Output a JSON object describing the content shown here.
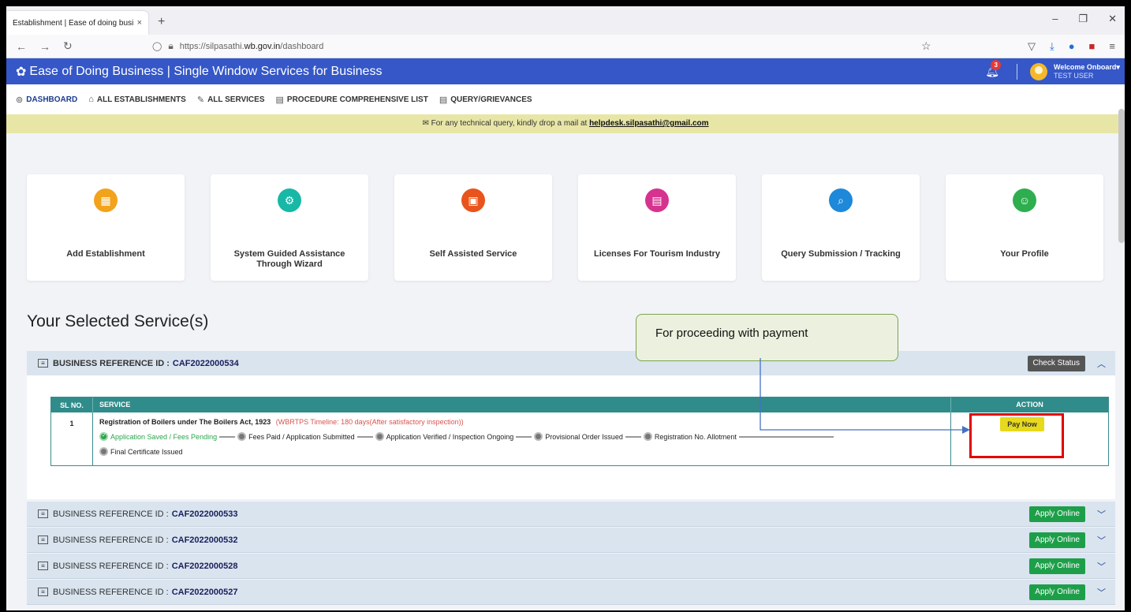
{
  "browser": {
    "tab_title": "Establishment | Ease of doing busin",
    "tab_close": "×",
    "new_tab": "+",
    "url_prefix": "https://silpasathi.",
    "url_host": "wb.gov.in",
    "url_path": "/dashboard",
    "win_minimize": "–",
    "win_restore": "❐",
    "win_close": "✕"
  },
  "header": {
    "title": "Ease of Doing Business | Single Window Services for Business",
    "notification_count": "3",
    "welcome": "Welcome Onboard",
    "user": "TEST USER"
  },
  "menu": [
    {
      "label": "DASHBOARD",
      "icon": "dashboard-icon",
      "glyph": "⊚"
    },
    {
      "label": "ALL ESTABLISHMENTS",
      "icon": "building-icon",
      "glyph": "⌂"
    },
    {
      "label": "ALL SERVICES",
      "icon": "wrench-icon",
      "glyph": "✎"
    },
    {
      "label": "PROCEDURE COMPREHENSIVE LIST",
      "icon": "list-icon",
      "glyph": "▤"
    },
    {
      "label": "QUERY/GRIEVANCES",
      "icon": "list-icon",
      "glyph": "▤"
    }
  ],
  "notice": {
    "text": "For any technical query, kindly drop a mail at",
    "email": "helpdesk.silpasathi@gmail.com"
  },
  "cards": [
    {
      "label": "Add Establishment",
      "color": "#f2a31b",
      "glyph": "▦"
    },
    {
      "label": "System Guided Assistance Through Wizard",
      "color": "#17b8a6",
      "glyph": "⚙"
    },
    {
      "label": "Self Assisted Service",
      "color": "#e8541c",
      "glyph": "▣"
    },
    {
      "label": "Licenses For Tourism Industry",
      "color": "#d6338f",
      "glyph": "▤"
    },
    {
      "label": "Query Submission / Tracking",
      "color": "#1e88d9",
      "glyph": "⌕"
    },
    {
      "label": "Your Profile",
      "color": "#2eae4f",
      "glyph": "☺"
    }
  ],
  "section_title": "Your Selected Service(s)",
  "callout": "For proceeding with payment",
  "business_label": "BUSINESS REFERENCE ID :",
  "open_business": {
    "id": "CAF2022000534",
    "button": "Check Status",
    "table": {
      "headers": [
        "SL NO.",
        "SERVICE",
        "ACTION"
      ],
      "row": {
        "sl": "1",
        "service": "Registration of Boilers under The Boilers Act, 1923",
        "timeline": "(WBRTPS Timeline: 180 days(After satisfactory inspection))",
        "steps": [
          "Application Saved / Fees Pending",
          "Fees Paid / Application Submitted",
          "Application Verified / Inspection Ongoing",
          "Provisional Order Issued",
          "Registration No. Allotment",
          "Final Certificate Issued"
        ],
        "action": "Pay Now"
      }
    }
  },
  "other_businesses": [
    {
      "id": "CAF2022000533",
      "button": "Apply Online"
    },
    {
      "id": "CAF2022000532",
      "button": "Apply Online"
    },
    {
      "id": "CAF2022000528",
      "button": "Apply Online"
    },
    {
      "id": "CAF2022000527",
      "button": "Apply Online"
    }
  ]
}
